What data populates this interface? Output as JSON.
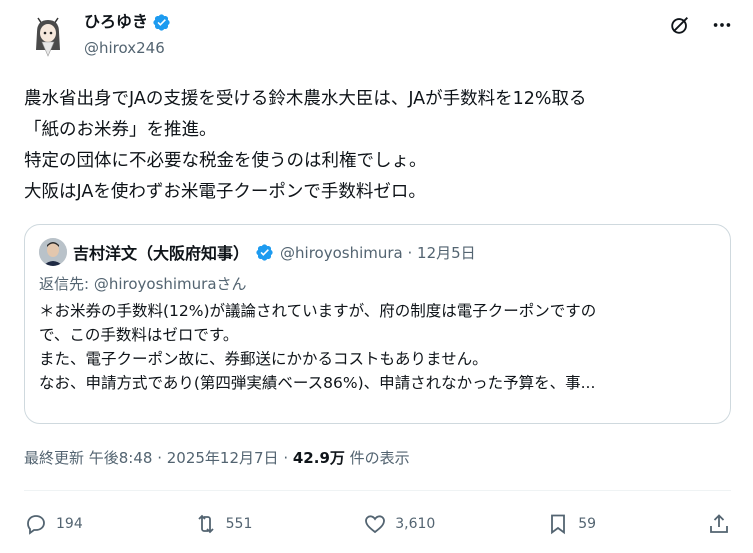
{
  "author": {
    "display_name": "ひろゆき",
    "handle": "@hirox246"
  },
  "tweet": {
    "lines": [
      "農水省出身でJAの支援を受ける鈴木農水大臣は、JAが手数料を12%取る",
      "「紙のお米券」を推進。",
      "特定の団体に不必要な税金を使うのは利権でしょ。",
      "大阪はJAを使わずお米電子クーポンで手数料ゼロ。"
    ]
  },
  "quote": {
    "name": "吉村洋文（大阪府知事）",
    "handle_date": "@hiroyoshimura · 12月5日",
    "reply_to": "返信先: @hiroyoshimuraさん",
    "lines": [
      "＊お米券の手数料(12%)が議論されていますが、府の制度は電子クーポンですの",
      "で、この手数料はゼロです。",
      "また、電子クーポン故に、券郵送にかかるコストもありません。",
      "なお、申請方式であり(第四弾実績ベース86%)、申請されなかった予算を、事..."
    ]
  },
  "meta": {
    "prefix": "最終更新 午後8:48 · 2025年12月7日 · ",
    "views": "42.9万",
    "suffix": " 件の表示"
  },
  "actions": {
    "replies": "194",
    "reposts": "551",
    "likes": "3,610",
    "bookmarks": "59"
  },
  "colors": {
    "verified": "#1d9bf0",
    "secondary_text": "#536471",
    "border": "#cfd9de"
  }
}
